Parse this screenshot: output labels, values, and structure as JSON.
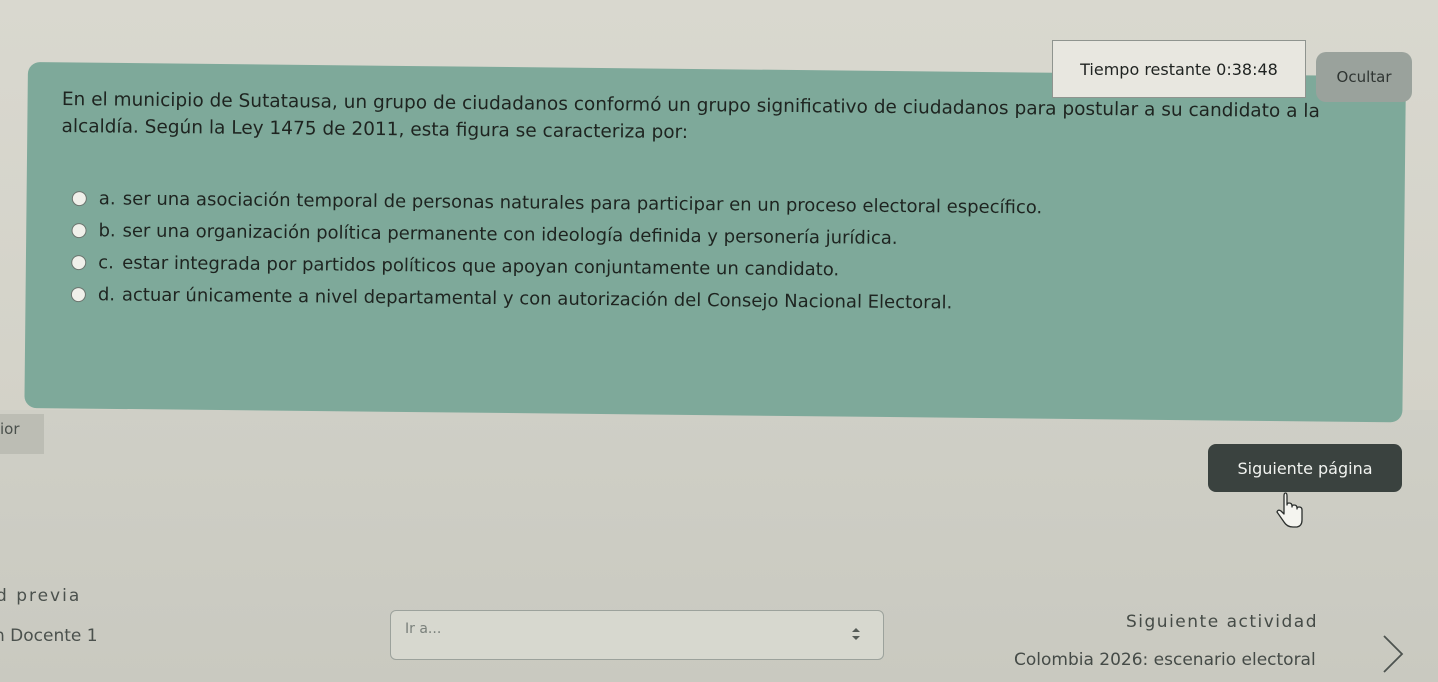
{
  "timer": {
    "label": "Tiempo restante 0:38:48",
    "hide_label": "Ocultar"
  },
  "question": {
    "text": "En el municipio de Sutatausa, un grupo de ciudadanos conformó un grupo significativo de ciudadanos para postular a su candidato a la alcaldía. Según la Ley 1475 de 2011, esta figura se caracteriza por:",
    "options": [
      {
        "letter": "a.",
        "text": "ser una asociación temporal de personas naturales para participar en un proceso electoral específico."
      },
      {
        "letter": "b.",
        "text": "ser una organización política permanente con ideología definida y personería jurídica."
      },
      {
        "letter": "c.",
        "text": "estar integrada por partidos políticos que apoyan conjuntamente un candidato."
      },
      {
        "letter": "d.",
        "text": "actuar únicamente a nivel departamental y con autorización del Consejo Nacional Electoral."
      }
    ]
  },
  "navigation": {
    "previous_page_label": "ior",
    "next_page_label": "Siguiente página"
  },
  "activity_nav": {
    "previous_label": "d previa",
    "previous_name": "n Docente 1",
    "goto_placeholder": "Ir a...",
    "next_label": "Siguiente actividad",
    "next_name": "Colombia 2026: escenario electoral"
  },
  "icons": {
    "radio": "radio-unchecked-icon",
    "cursor": "hand-pointer-icon",
    "select": "select-arrows-icon",
    "next": "chevron-right-icon"
  }
}
